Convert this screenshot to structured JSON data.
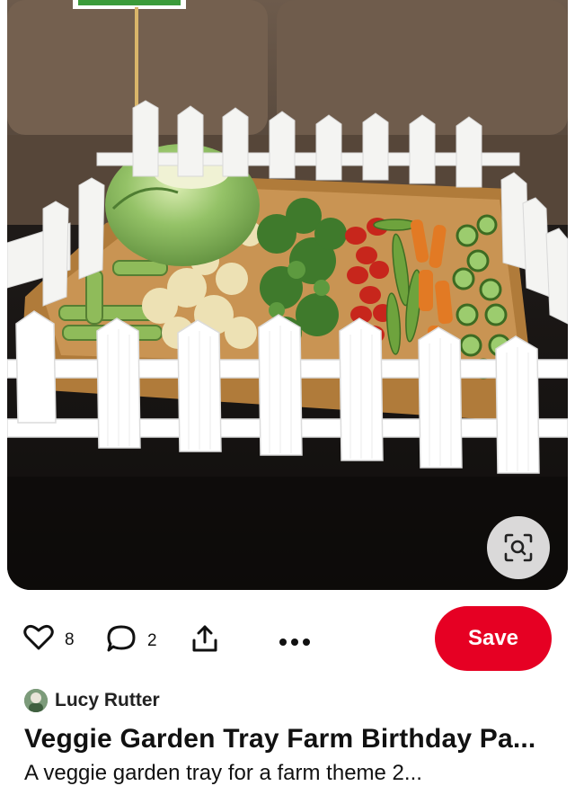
{
  "pin": {
    "image_alt": "Veggie garden tray with white picket fence",
    "like_count": "8",
    "comment_count": "2",
    "save_label": "Save",
    "author": "Lucy Rutter",
    "title": "Veggie Garden Tray Farm Birthday Pa...",
    "description": "A veggie garden tray for a farm theme 2..."
  },
  "icons": {
    "like": "heart-icon",
    "comment": "comment-icon",
    "share": "share-icon",
    "more": "more-icon",
    "lens": "visual-search-icon"
  },
  "colors": {
    "save": "#e60023",
    "text": "#111111"
  }
}
